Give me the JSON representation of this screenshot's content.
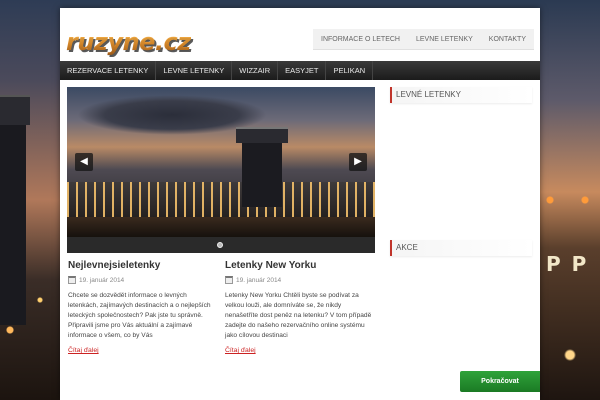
{
  "site": {
    "logo_text": "ruzyne.cz"
  },
  "top_menu": {
    "items": [
      "INFORMACE O LETECH",
      "LEVNE LETENKY",
      "KONTAKTY"
    ]
  },
  "nav": {
    "items": [
      "REZERVACE LETENKY",
      "LEVNE LETENKY",
      "WIZZAIR",
      "EASYJET",
      "PELIKAN"
    ]
  },
  "slider": {
    "prev_symbol": "◀",
    "next_symbol": "▶"
  },
  "posts": [
    {
      "title": "Nejlevnejsieletenky",
      "date": "19. január 2014",
      "text": "Chcete se dozvědět informace o levných letenkách, zajímavých destinacích a o nejlepších leteckých společnostech? Pak jste tu správně. Připravili jsme pro Vás aktuální a zajímavé informace o všem, co by Vás",
      "more": "Čítaj ďalej"
    },
    {
      "title": "Letenky New Yorku",
      "date": "19. január 2014",
      "text": "Letenky New Yorku Chtěli byste se podívat za velkou louži, ale domníváte se, že nikdy nenašetříte dost peněz na letenku? V tom případě zadejte do našeho rezervačního online systému jako cílovou destinaci",
      "more": "Čítaj ďalej"
    }
  ],
  "sidebar": {
    "heading_1": "LEVNÉ LETENKY",
    "heading_2": "AKCE"
  },
  "background": {
    "sign_text": "P P"
  },
  "continue_button": {
    "label": "Pokračovat"
  }
}
